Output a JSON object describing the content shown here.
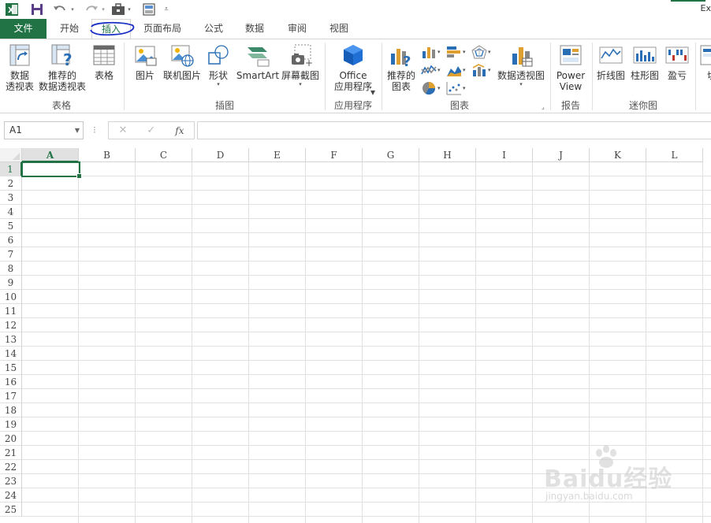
{
  "app": {
    "title_partial": "Ex",
    "quick_access": [
      "excel-logo-icon",
      "save-icon",
      "undo-icon",
      "redo-icon",
      "briefcase-icon",
      "form-icon",
      "customize-icon"
    ]
  },
  "tabs": [
    {
      "label": "文件",
      "kind": "file"
    },
    {
      "label": "开始"
    },
    {
      "label": "插入",
      "active": true
    },
    {
      "label": "页面布局"
    },
    {
      "label": "公式"
    },
    {
      "label": "数据"
    },
    {
      "label": "审阅"
    },
    {
      "label": "视图"
    }
  ],
  "ribbon": {
    "groups": {
      "tables": "表格",
      "illustrations": "插图",
      "apps": "应用程序",
      "charts": "图表",
      "reports": "报告",
      "sparklines": "迷你图"
    },
    "buttons": {
      "pivot_table": "数据\n透视表",
      "recommended_pivot": "推荐的\n数据透视表",
      "table": "表格",
      "pictures": "图片",
      "online_pictures": "联机图片",
      "shapes": "形状",
      "smartart": "SmartArt",
      "screenshot": "屏幕截图",
      "office_apps": "Office\n应用程序",
      "recommended_charts": "推荐的\n图表",
      "pivot_chart": "数据透视图",
      "power_view": "Power\nView",
      "line_sparkline": "折线图",
      "column_sparkline": "柱形图",
      "winloss_sparkline": "盈亏",
      "slicer_partial": "切"
    }
  },
  "formula_bar": {
    "name_box": "A1",
    "dots": "⁝",
    "cancel": "✕",
    "enter": "✓",
    "fx": "fx",
    "value": ""
  },
  "sheet": {
    "columns": [
      "A",
      "B",
      "C",
      "D",
      "E",
      "F",
      "G",
      "H",
      "I",
      "J",
      "K",
      "L"
    ],
    "rows": [
      "1",
      "2",
      "3",
      "4",
      "5",
      "6",
      "7",
      "8",
      "9",
      "10",
      "11",
      "12",
      "13",
      "14",
      "15",
      "16",
      "17",
      "18",
      "19",
      "20",
      "21",
      "22",
      "23",
      "24",
      "25"
    ],
    "selected_cell": "A1"
  },
  "watermark": {
    "text": "Baidu经验",
    "url": "jingyan.baidu.com"
  },
  "colors": {
    "excel_green": "#217346",
    "annotation_blue": "#1a2fc4"
  }
}
